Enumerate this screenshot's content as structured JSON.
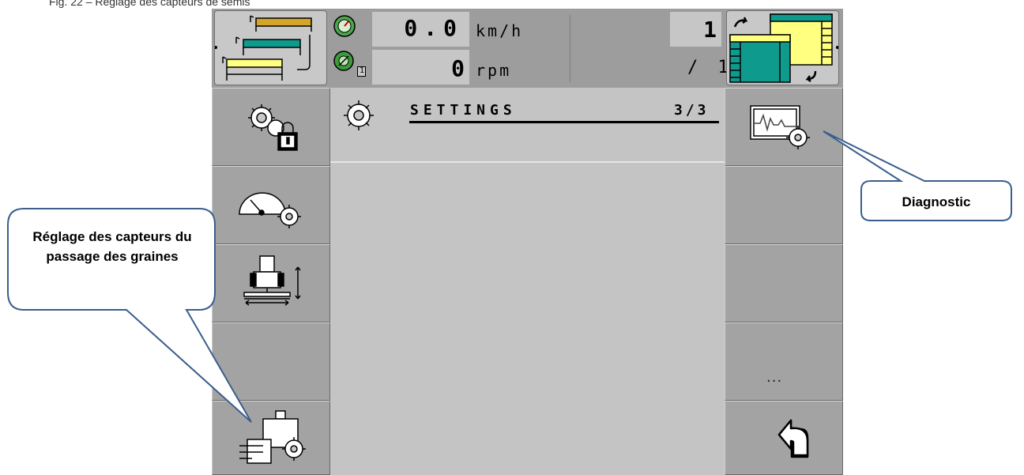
{
  "caption": "Fig. 22 – Réglage des capteurs de semis",
  "header": {
    "speed_value": "0.0",
    "speed_unit": "km/h",
    "rpm_value": "0",
    "rpm_unit": "rpm",
    "rpm_index": "1",
    "counter_top": "1",
    "counter_bottom": "/ 1"
  },
  "main": {
    "title": "SETTINGS",
    "page": "3/3"
  },
  "left_menu": [
    {
      "icon": "settings-lock-icon"
    },
    {
      "icon": "speedometer-settings-icon"
    },
    {
      "icon": "tractor-implement-icon"
    },
    {
      "icon": ""
    },
    {
      "icon": "seed-sensor-settings-icon"
    }
  ],
  "right_menu": [
    {
      "icon": "diagnostic-icon"
    },
    {
      "icon": ""
    },
    {
      "icon": ""
    },
    {
      "label": "..."
    },
    {
      "icon": "back-icon"
    }
  ],
  "callouts": {
    "left": "Réglage des capteurs du passage des graines",
    "right": "Diagnostic"
  },
  "colors": {
    "teal": "#0e9b8e",
    "yellow": "#ffff80",
    "orange": "#d5a52a",
    "panel": "#c4c4c4",
    "callout_border": "#3b5e8c"
  }
}
